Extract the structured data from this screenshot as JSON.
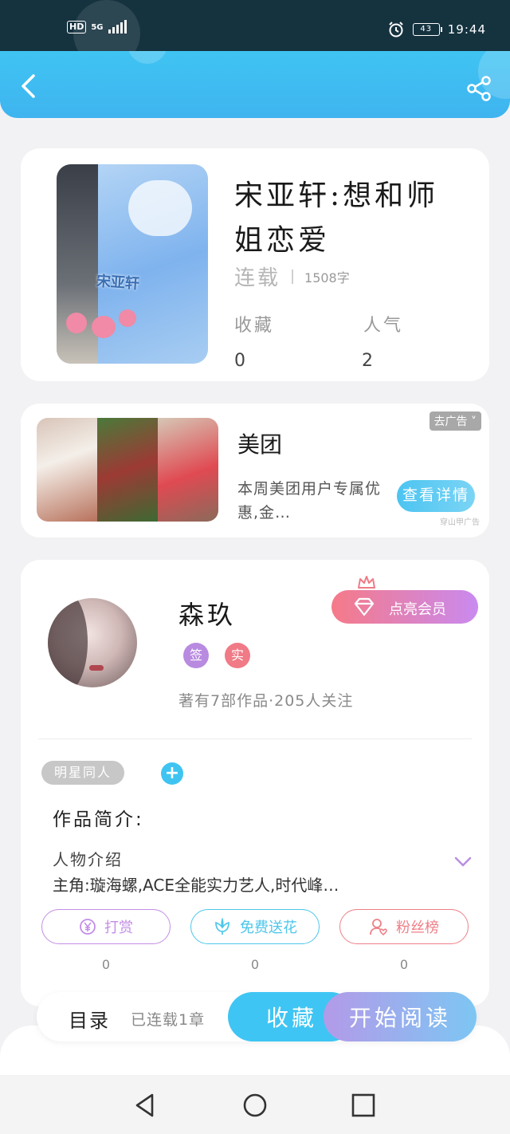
{
  "status_bar": {
    "network_badge": "HD",
    "network_type": "5G",
    "battery_level": "43",
    "time": "19:44",
    "icons": [
      "alarm-icon",
      "battery-icon",
      "signal-icon"
    ]
  },
  "header": {
    "back_icon": "chevron-left-icon",
    "share_icon": "share-icon",
    "color": "#3fc4f2"
  },
  "book": {
    "title": "宋亚轩:想和师姐恋爱",
    "status": "连载",
    "word_count": "1508字",
    "cover_text": "宋亚轩",
    "stats": [
      {
        "label": "收藏",
        "value": "0"
      },
      {
        "label": "人气",
        "value": "2"
      }
    ]
  },
  "ad": {
    "title": "美团",
    "description": "本周美团用户专属优惠,金…",
    "tag": "去广告 ˅",
    "detail_button": "查看详情",
    "source": "穿山甲广告"
  },
  "author": {
    "name": "森玖",
    "badges": [
      {
        "text": "签",
        "color": "#b88ae0"
      },
      {
        "text": "实",
        "color": "#f07a86"
      }
    ],
    "stats": "著有7部作品·205人关注",
    "vip_button": "点亮会员",
    "tag": "明星同人",
    "add_tag": "+",
    "intro_heading": "作品简介:",
    "intro_line1": "人物介绍",
    "intro_line2": "主角:璇海螺,ACE全能实力艺人,时代峰…",
    "actions": [
      {
        "label": "打赏",
        "count": "0",
        "icon": "yen-coin-icon",
        "color": "#c38ee6"
      },
      {
        "label": "免费送花",
        "count": "0",
        "icon": "flower-icon",
        "color": "#4cc6ea"
      },
      {
        "label": "粉丝榜",
        "count": "0",
        "icon": "fan-user-icon",
        "color": "#ee8088"
      }
    ]
  },
  "bottom_bar": {
    "toc_label": "目录",
    "toc_progress": "已连载1章",
    "collect_button": "收藏",
    "read_button": "开始阅读"
  },
  "nav_bar": {
    "buttons": [
      "back-triangle-icon",
      "home-circle-icon",
      "recents-square-icon"
    ]
  }
}
